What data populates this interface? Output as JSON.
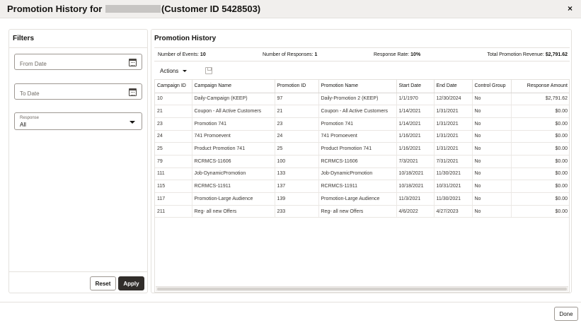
{
  "modal": {
    "title_prefix": "Promotion History for",
    "title_suffix": "(Customer ID 5428503)",
    "close_label": "×",
    "done_label": "Done"
  },
  "filters": {
    "title": "Filters",
    "from_date_placeholder": "From Date",
    "to_date_placeholder": "To Date",
    "response_label": "Response",
    "response_value": "All",
    "reset_label": "Reset",
    "apply_label": "Apply"
  },
  "history": {
    "title": "Promotion History",
    "summary": {
      "events_label": "Number of Events:",
      "events_value": "10",
      "responses_label": "Number of Responses:",
      "responses_value": "1",
      "rate_label": "Response Rate:",
      "rate_value": "10%",
      "revenue_label": "Total Promotion Revenue:",
      "revenue_value": "$2,791.62"
    },
    "actions_label": "Actions",
    "columns": [
      "Campaign ID",
      "Campaign Name",
      "Promotion ID",
      "Promotion Name",
      "Start Date",
      "End Date",
      "Control Group",
      "Response Amount"
    ],
    "rows": [
      [
        "10",
        "Daily-Campaign (KEEP)",
        "97",
        "Daily-Promotion 2 (KEEP)",
        "1/1/1970",
        "12/30/2024",
        "No",
        "$2,791.62"
      ],
      [
        "21",
        "Coupon - All Active Customers",
        "21",
        "Coupon - All Active Customers",
        "1/14/2021",
        "1/31/2021",
        "No",
        "$0.00"
      ],
      [
        "23",
        "Promotion 741",
        "23",
        "Promotion 741",
        "1/14/2021",
        "1/31/2021",
        "No",
        "$0.00"
      ],
      [
        "24",
        "741 Promoevent",
        "24",
        "741 Promoevent",
        "1/16/2021",
        "1/31/2021",
        "No",
        "$0.00"
      ],
      [
        "25",
        "Product Promotion 741",
        "25",
        "Product Promotion 741",
        "1/16/2021",
        "1/31/2021",
        "No",
        "$0.00"
      ],
      [
        "79",
        "RCRMCS-11606",
        "100",
        "RCRMCS-11606",
        "7/3/2021",
        "7/31/2021",
        "No",
        "$0.00"
      ],
      [
        "111",
        "Job-DynamicPromotion",
        "133",
        "Job-DynamicPromotion",
        "10/18/2021",
        "11/30/2021",
        "No",
        "$0.00"
      ],
      [
        "115",
        "RCRMCS-11911",
        "137",
        "RCRMCS-11911",
        "10/18/2021",
        "10/31/2021",
        "No",
        "$0.00"
      ],
      [
        "117",
        "Promotion-Large Audience",
        "139",
        "Promotion-Large Audience",
        "11/3/2021",
        "11/30/2021",
        "No",
        "$0.00"
      ],
      [
        "211",
        "Reg- all new Offers",
        "233",
        "Reg- all new Offers",
        "4/6/2022",
        "4/27/2023",
        "No",
        "$0.00"
      ]
    ]
  }
}
